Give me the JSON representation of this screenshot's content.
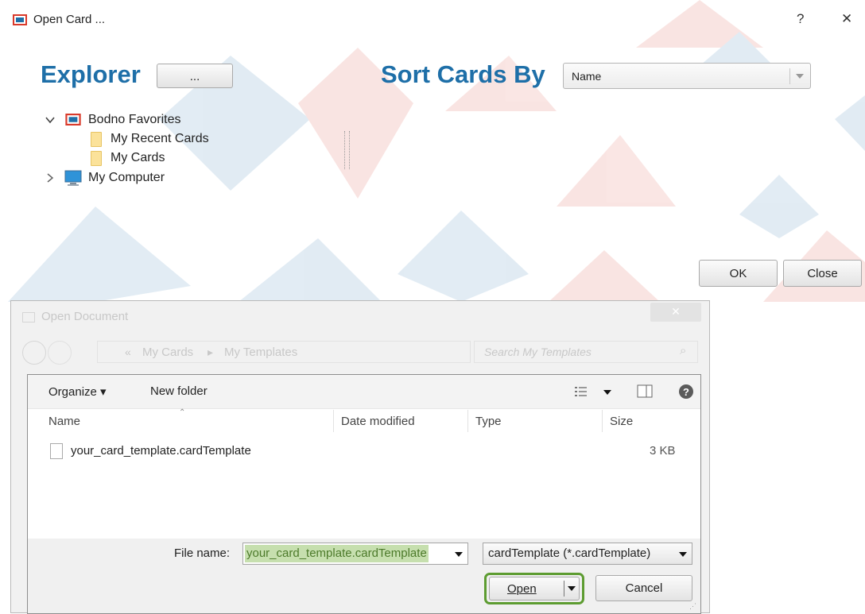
{
  "window": {
    "title": "Open Card ...",
    "help_glyph": "?",
    "close_glyph": "✕"
  },
  "explorer": {
    "label": "Explorer",
    "browse_button": "..."
  },
  "sort": {
    "label": "Sort Cards By",
    "selected": "Name"
  },
  "tree": {
    "root": "Bodno Favorites",
    "children": [
      "My Recent Cards",
      "My Cards"
    ],
    "computer": "My Computer"
  },
  "actions": {
    "ok": "OK",
    "close": "Close"
  },
  "doc_dialog": {
    "title": "Open Document",
    "breadcrumb": [
      "«",
      "My Cards",
      "My Templates"
    ],
    "search_placeholder": "Search My Templates",
    "toolbar": {
      "organize": "Organize",
      "new_folder": "New folder"
    },
    "columns": {
      "name": "Name",
      "date": "Date modified",
      "type": "Type",
      "size": "Size"
    },
    "files": [
      {
        "name": "your_card_template.cardTemplate",
        "date": "",
        "type": "",
        "size": "3 KB"
      }
    ],
    "file_name_label": "File name:",
    "file_name_value": "your_card_template.cardTemplate",
    "file_type": "cardTemplate (*.cardTemplate)",
    "open_button": "Open",
    "cancel_button": "Cancel"
  },
  "colors": {
    "accent_blue": "#1e6fa8",
    "accent_red": "#d93a2b",
    "highlight_green": "#5d9c31"
  }
}
